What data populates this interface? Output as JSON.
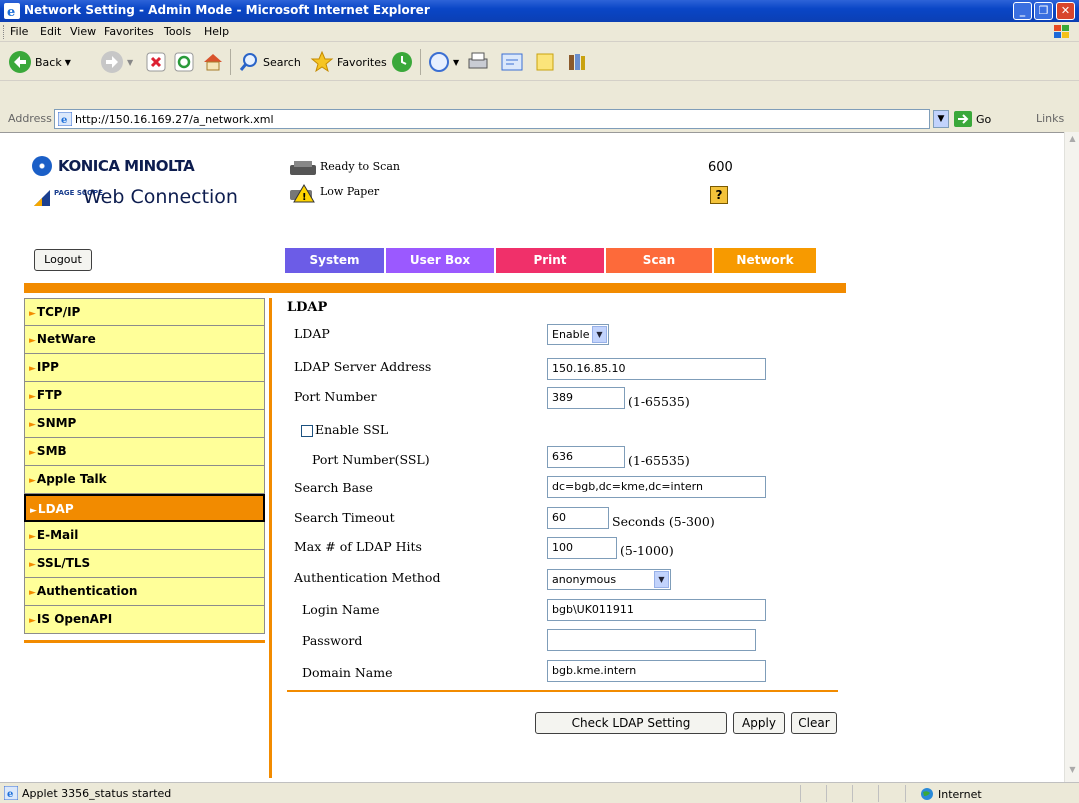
{
  "window": {
    "title": "Network Setting - Admin Mode - Microsoft Internet Explorer",
    "min_icon": "_",
    "max_icon": "❐",
    "close_icon": "✕"
  },
  "menu": [
    "File",
    "Edit",
    "View",
    "Favorites",
    "Tools",
    "Help"
  ],
  "toolbar": {
    "back_label": "Back",
    "search_label": "Search",
    "favorites_label": "Favorites"
  },
  "address": {
    "label": "Address",
    "url": "http://150.16.169.27/a_network.xml",
    "go_label": "Go",
    "links_label": "Links"
  },
  "header": {
    "brand": "KONICA MINOLTA",
    "pagescope": "PAGE SCOPE",
    "web_connection": "Web Connection",
    "status1": "Ready to Scan",
    "status2": "Low Paper",
    "count": "600",
    "help": "?"
  },
  "logout_label": "Logout",
  "tabs": [
    {
      "label": "System",
      "color": "#6c5ce7"
    },
    {
      "label": "User Box",
      "color": "#9b59ff"
    },
    {
      "label": "Print",
      "color": "#f0306a"
    },
    {
      "label": "Scan",
      "color": "#fd6a3a"
    },
    {
      "label": "Network",
      "color": "#f79a00"
    }
  ],
  "nav": [
    "TCP/IP",
    "NetWare",
    "IPP",
    "FTP",
    "SNMP",
    "SMB",
    "Apple Talk",
    "LDAP",
    "E-Mail",
    "SSL/TLS",
    "Authentication",
    "IS OpenAPI"
  ],
  "nav_active": "LDAP",
  "form": {
    "title": "LDAP",
    "ldap_label": "LDAP",
    "ldap_value": "Enable",
    "server_label": "LDAP Server Address",
    "server_value": "150.16.85.10",
    "port_label": "Port Number",
    "port_value": "389",
    "port_range": "(1-65535)",
    "ssl_label": "Enable SSL",
    "ssl_checked": false,
    "ssl_port_label": "Port Number(SSL)",
    "ssl_port_value": "636",
    "ssl_port_range": "(1-65535)",
    "search_base_label": "Search Base",
    "search_base_value": "dc=bgb,dc=kme,dc=intern",
    "timeout_label": "Search Timeout",
    "timeout_value": "60",
    "timeout_range": "Seconds (5-300)",
    "max_hits_label": "Max # of LDAP Hits",
    "max_hits_value": "100",
    "max_hits_range": "(5-1000)",
    "auth_label": "Authentication Method",
    "auth_value": "anonymous",
    "login_label": "Login Name",
    "login_value": "bgb\\UK011911",
    "password_label": "Password",
    "password_value": "",
    "domain_label": "Domain Name",
    "domain_value": "bgb.kme.intern"
  },
  "buttons": {
    "check": "Check LDAP Setting",
    "apply": "Apply",
    "clear": "Clear"
  },
  "statusbar": {
    "message": "Applet 3356_status started",
    "zone": "Internet"
  }
}
